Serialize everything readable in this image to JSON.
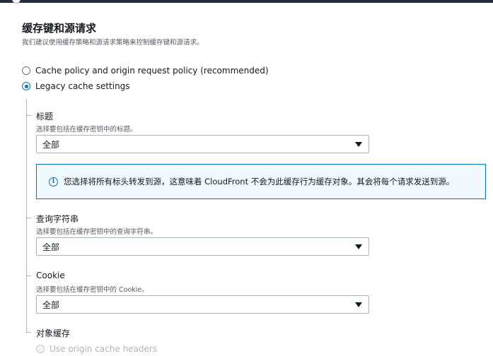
{
  "section": {
    "title": "缓存键和源请求",
    "description": "我们建议使用缓存策略和源请求策略来控制缓存键和源请求。"
  },
  "options": {
    "policy_recommended": "Cache policy and origin request policy (recommended)",
    "legacy": "Legacy cache settings",
    "selected": "legacy"
  },
  "headers": {
    "label": "标题",
    "description": "选择要包括在缓存密钥中的标题。",
    "value": "全部"
  },
  "info": {
    "message": "您选择将所有标头转发到源，这意味着 CloudFront 不会为此缓存行为缓存对象。其会将每个请求发送到源。"
  },
  "query_strings": {
    "label": "查询字符串",
    "description": "选择要包括在缓存密钥中的查询字符串。",
    "value": "全部"
  },
  "cookies": {
    "label": "Cookie",
    "description": "选择要包括在缓存密钥中的 Cookie。",
    "value": "全部"
  },
  "object_caching": {
    "label": "对象缓存",
    "use_origin_headers": "Use origin cache headers"
  },
  "colors": {
    "accent": "#0073bb",
    "info_bg": "#f1faff",
    "topbar": "#232f3e"
  }
}
